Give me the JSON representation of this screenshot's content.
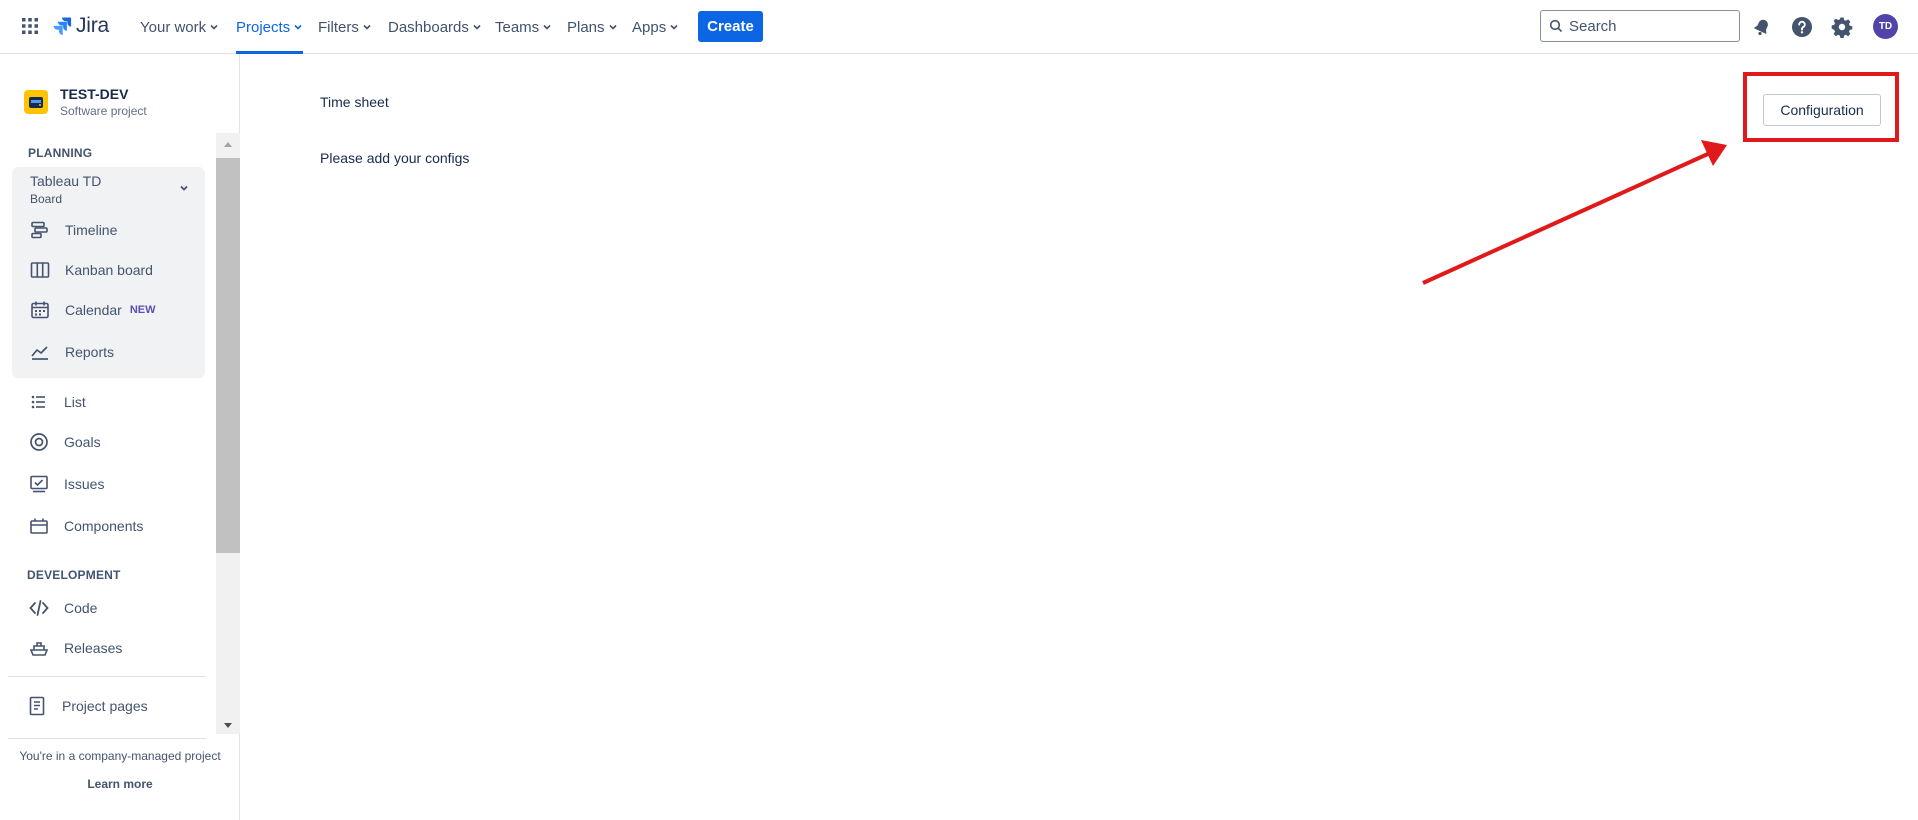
{
  "app": {
    "name": "Jira"
  },
  "topnav": {
    "items": [
      {
        "label": "Your work",
        "active": false
      },
      {
        "label": "Projects",
        "active": true
      },
      {
        "label": "Filters",
        "active": false
      },
      {
        "label": "Dashboards",
        "active": false
      },
      {
        "label": "Teams",
        "active": false
      },
      {
        "label": "Plans",
        "active": false
      },
      {
        "label": "Apps",
        "active": false
      }
    ],
    "create_label": "Create",
    "search_placeholder": "Search",
    "avatar_initials": "TD",
    "accent_color": "#0c66e4"
  },
  "sidebar": {
    "project_name": "TEST-DEV",
    "project_type": "Software project",
    "planning_label": "PLANNING",
    "board": {
      "name": "Tableau TD",
      "sub": "Board"
    },
    "planning_items": [
      {
        "label": "Timeline",
        "icon": "timeline-icon"
      },
      {
        "label": "Kanban board",
        "icon": "kanban-icon"
      },
      {
        "label": "Calendar",
        "icon": "calendar-icon",
        "badge": "NEW"
      },
      {
        "label": "Reports",
        "icon": "reports-icon"
      }
    ],
    "items": [
      {
        "label": "List",
        "icon": "list-icon"
      },
      {
        "label": "Goals",
        "icon": "goals-icon"
      },
      {
        "label": "Issues",
        "icon": "issues-icon"
      },
      {
        "label": "Components",
        "icon": "components-icon"
      }
    ],
    "development_label": "DEVELOPMENT",
    "dev_items": [
      {
        "label": "Code",
        "icon": "code-icon"
      },
      {
        "label": "Releases",
        "icon": "releases-icon"
      }
    ],
    "project_pages_label": "Project pages",
    "footer_note": "You're in a company-managed project",
    "learn_more": "Learn more"
  },
  "main": {
    "title": "Time sheet",
    "message": "Please add your configs",
    "config_button": "Configuration"
  },
  "annotation": {
    "color": "#e0191b"
  }
}
